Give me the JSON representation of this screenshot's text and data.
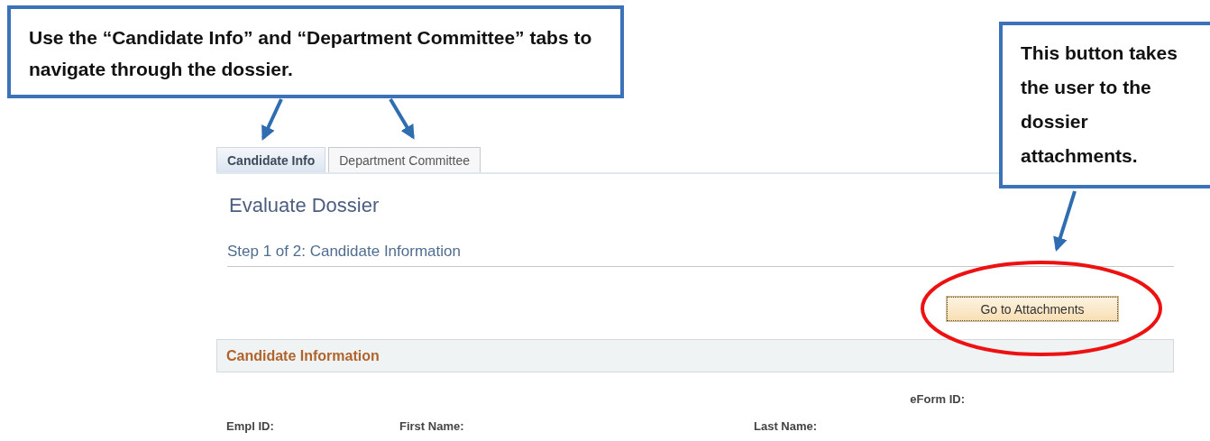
{
  "callouts": [
    {
      "text": "Use the “Candidate Info” and “Department Committee” tabs to navigate through the dossier."
    },
    {
      "text": "This button takes the user to the dossier attachments."
    }
  ],
  "tabs": [
    {
      "label": "Candidate Info",
      "selected": true
    },
    {
      "label": "Department Committee",
      "selected": false
    }
  ],
  "page_title": "Evaluate Dossier",
  "step": "Step 1 of 2: Candidate Information",
  "attachments_button": "Go to Attachments",
  "section": {
    "title": "Candidate Information"
  },
  "fields": {
    "eform_id": "eForm ID:",
    "empl_id": "Empl ID:",
    "first_name": "First Name:",
    "last_name": "Last Name:"
  }
}
